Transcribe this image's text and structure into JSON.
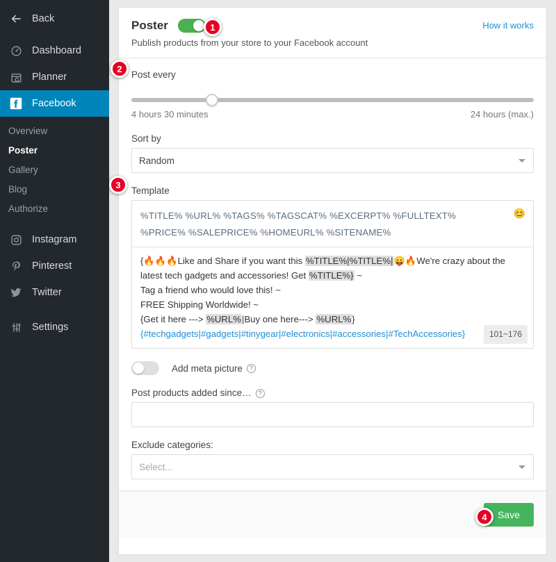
{
  "sidebar": {
    "top_items": [
      {
        "label": "Back",
        "icon": "arrow-left-icon"
      },
      {
        "label": "Dashboard",
        "icon": "gauge-icon"
      },
      {
        "label": "Planner",
        "icon": "calendar-refresh-icon"
      }
    ],
    "active_item": {
      "label": "Facebook",
      "icon": "facebook-icon"
    },
    "sub_items": [
      {
        "label": "Overview",
        "current": false
      },
      {
        "label": "Poster",
        "current": true
      },
      {
        "label": "Gallery",
        "current": false
      },
      {
        "label": "Blog",
        "current": false
      },
      {
        "label": "Authorize",
        "current": false
      }
    ],
    "social_items": [
      {
        "label": "Instagram",
        "icon": "instagram-icon"
      },
      {
        "label": "Pinterest",
        "icon": "pinterest-icon"
      },
      {
        "label": "Twitter",
        "icon": "twitter-icon"
      }
    ],
    "settings_item": {
      "label": "Settings",
      "icon": "sliders-icon"
    },
    "active_color": "#0085ba",
    "background_color": "#23282d"
  },
  "header": {
    "title": "Poster",
    "subtitle": "Publish products from your store to your Facebook account",
    "how_it_works": "How it works",
    "enabled": true
  },
  "post_every": {
    "label": "Post every",
    "value_label": "4 hours 30 minutes",
    "max_label": "24 hours (max.)",
    "thumb_percent": 18.5
  },
  "sort_by": {
    "label": "Sort by",
    "value": "Random"
  },
  "template": {
    "label": "Template",
    "tag_line_1": "%TITLE%  %URL%  %TAGS%  %TAGSCAT%  %EXCERPT%  %FULLTEXT%",
    "tag_line_2": "%PRICE%  %SALEPRICE%  %HOMEURL%  %SITENAME%",
    "emoji_icon": "smiley-icon",
    "char_count": "101~176",
    "lines": {
      "l1_a": "{🔥🔥🔥Like and Share if you want this ",
      "l1_tok1": "%TITLE%|%TITLE%|",
      "l1_b": "😛🔥We're crazy about the",
      "l2_a": "latest tech gadgets and accessories! Get ",
      "l2_tok": "%TITLE%}",
      "l2_b": " ~",
      "l3": "Tag a friend who would love this! ~",
      "l4": "FREE Shipping Worldwide! ~",
      "l5_a": "{Get it here ---> ",
      "l5_tok1": "%URL%",
      "l5_b": "|Buy one here---> ",
      "l5_tok2": "%URL%",
      "l5_c": "}",
      "l6_open": "{",
      "l6_tags": "#techgadgets|#gadgets|#tinygear|#electronics|#accessories|#TechAccessories",
      "l6_close": "}"
    }
  },
  "meta_picture": {
    "label": "Add meta picture",
    "enabled": false,
    "help_icon": "question-circle-icon"
  },
  "added_since": {
    "label": "Post products added since…",
    "value": "",
    "placeholder": "",
    "help_icon": "question-circle-icon"
  },
  "exclude_categories": {
    "label": "Exclude categories:",
    "placeholder": "Select..."
  },
  "footer": {
    "save_label": "Save",
    "save_color": "#45b45f"
  },
  "badges": {
    "b1": "1",
    "b2": "2",
    "b3": "3",
    "b4": "4",
    "color": "#e60023"
  }
}
